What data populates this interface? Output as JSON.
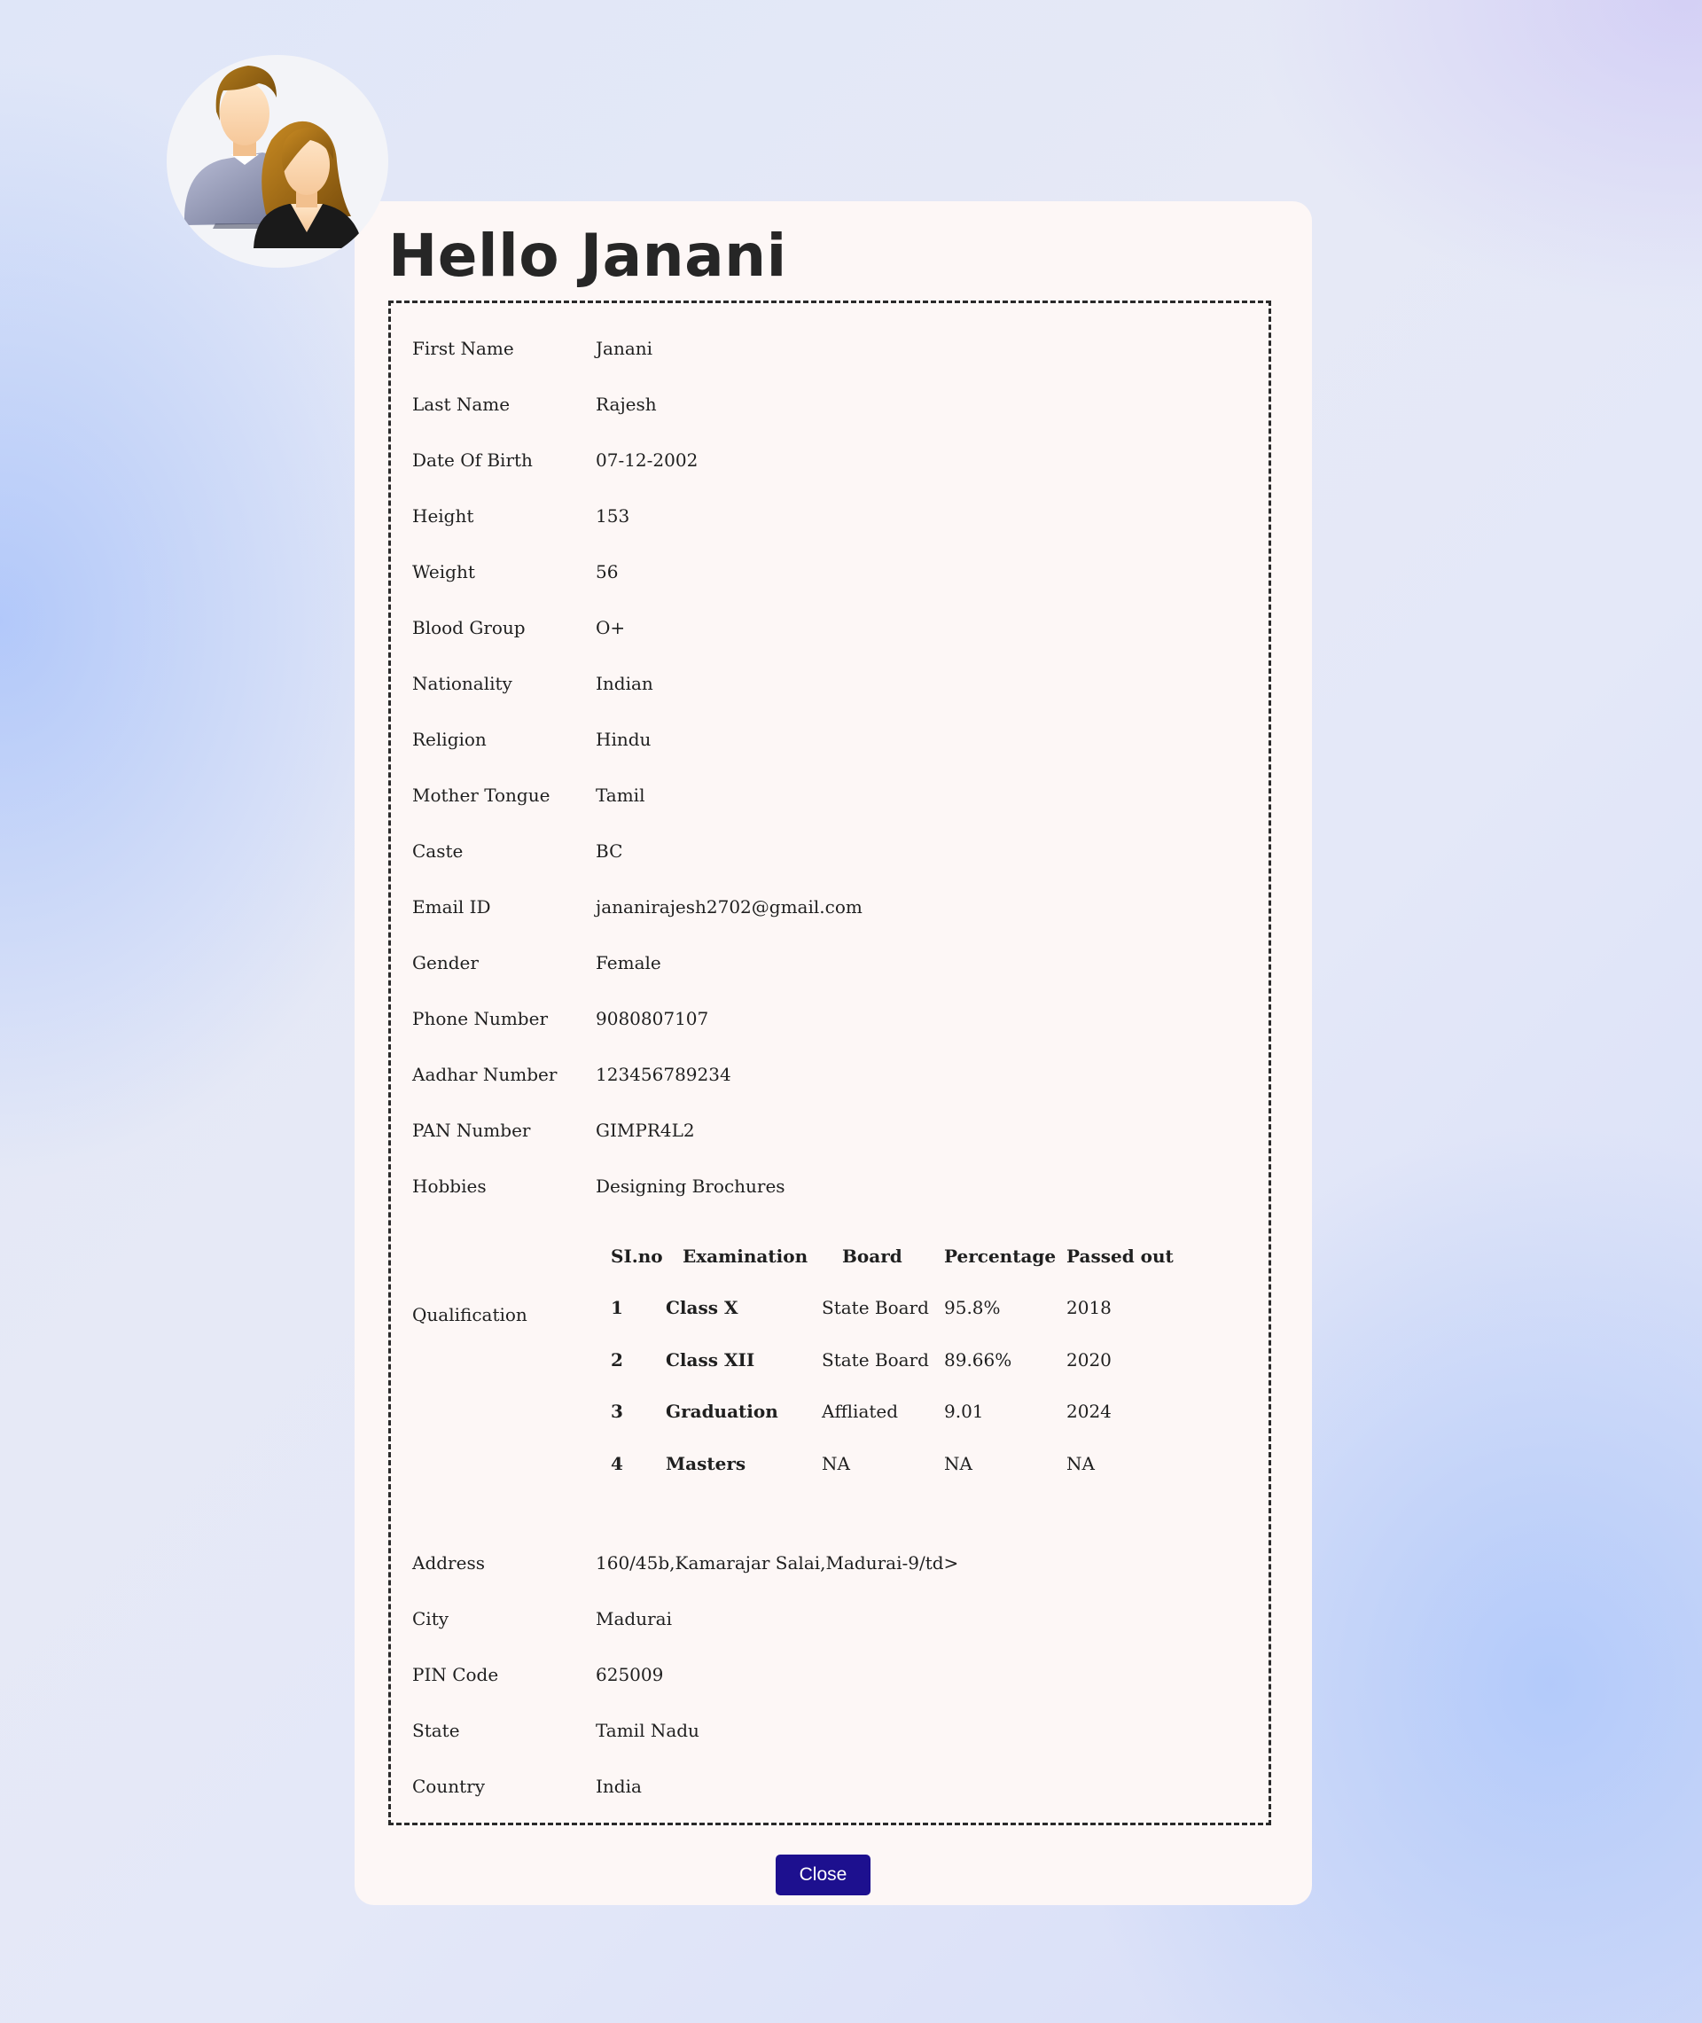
{
  "header": {
    "title": "Hello Janani"
  },
  "avatar_icon": "people-couple-icon",
  "fields_top": [
    {
      "label": "First Name",
      "value": "Janani"
    },
    {
      "label": "Last Name",
      "value": "Rajesh"
    },
    {
      "label": "Date Of Birth",
      "value": "07-12-2002"
    },
    {
      "label": "Height",
      "value": "153"
    },
    {
      "label": "Weight",
      "value": "56"
    },
    {
      "label": "Blood Group",
      "value": "O+"
    },
    {
      "label": "Nationality",
      "value": "Indian"
    },
    {
      "label": "Religion",
      "value": "Hindu"
    },
    {
      "label": "Mother Tongue",
      "value": "Tamil"
    },
    {
      "label": "Caste",
      "value": "BC"
    },
    {
      "label": "Email ID",
      "value": "jananirajesh2702@gmail.com"
    },
    {
      "label": "Gender",
      "value": "Female"
    },
    {
      "label": "Phone Number",
      "value": "9080807107"
    },
    {
      "label": "Aadhar Number",
      "value": "123456789234"
    },
    {
      "label": "PAN Number",
      "value": "GIMPR4L2"
    },
    {
      "label": "Hobbies",
      "value": "Designing Brochures"
    }
  ],
  "qualification": {
    "label": "Qualification",
    "headers": [
      "SI.no",
      "Examination",
      "Board",
      "Percentage",
      "Passed out"
    ],
    "rows": [
      [
        "1",
        "Class X",
        "State Board",
        "95.8%",
        "2018"
      ],
      [
        "2",
        "Class XII",
        "State Board",
        "89.66%",
        "2020"
      ],
      [
        "3",
        "Graduation",
        "Affliated",
        "9.01",
        "2024"
      ],
      [
        "4",
        "Masters",
        "NA",
        "NA",
        "NA"
      ]
    ]
  },
  "fields_bottom": [
    {
      "label": "Address",
      "value": "160/45b,Kamarajar Salai,Madurai-9/td>"
    },
    {
      "label": "City",
      "value": "Madurai"
    },
    {
      "label": "PIN Code",
      "value": "625009"
    },
    {
      "label": "State",
      "value": "Tamil Nadu"
    },
    {
      "label": "Country",
      "value": "India"
    }
  ],
  "actions": {
    "close_label": "Close"
  },
  "colors": {
    "button_bg": "#1d108f",
    "card_bg": "#fdf7f6",
    "text": "#1f1f1f"
  }
}
